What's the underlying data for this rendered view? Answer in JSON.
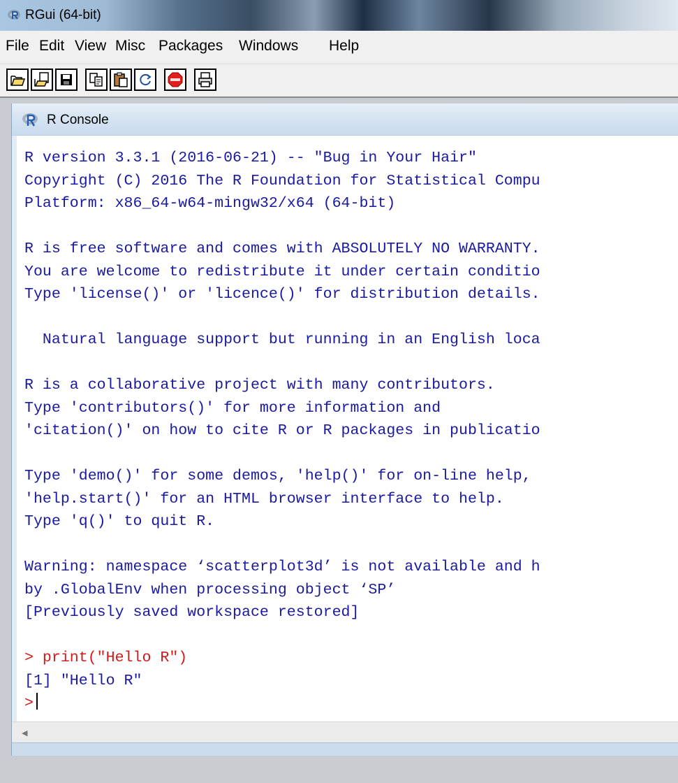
{
  "window": {
    "title": "RGui (64-bit)"
  },
  "menubar": {
    "items": [
      "File",
      "Edit",
      "View",
      "Misc",
      "Packages",
      "Windows",
      "Help"
    ]
  },
  "toolbar": {
    "buttons": [
      {
        "icon": "open-script-icon"
      },
      {
        "icon": "load-workspace-icon"
      },
      {
        "icon": "save-icon"
      },
      {
        "icon": "copy-icon"
      },
      {
        "icon": "paste-icon"
      },
      {
        "icon": "copy-paste-icon"
      },
      {
        "icon": "stop-icon"
      },
      {
        "icon": "print-icon"
      }
    ]
  },
  "console": {
    "title": "R Console",
    "lines": [
      {
        "text": "R version 3.3.1 (2016-06-21) -- \"Bug in Your Hair\"",
        "kind": "out"
      },
      {
        "text": "Copyright (C) 2016 The R Foundation for Statistical Compu",
        "kind": "out"
      },
      {
        "text": "Platform: x86_64-w64-mingw32/x64 (64-bit)",
        "kind": "out"
      },
      {
        "text": "",
        "kind": "out"
      },
      {
        "text": "R is free software and comes with ABSOLUTELY NO WARRANTY.",
        "kind": "out"
      },
      {
        "text": "You are welcome to redistribute it under certain conditio",
        "kind": "out"
      },
      {
        "text": "Type 'license()' or 'licence()' for distribution details.",
        "kind": "out"
      },
      {
        "text": "",
        "kind": "out"
      },
      {
        "text": "  Natural language support but running in an English loca",
        "kind": "out"
      },
      {
        "text": "",
        "kind": "out"
      },
      {
        "text": "R is a collaborative project with many contributors.",
        "kind": "out"
      },
      {
        "text": "Type 'contributors()' for more information and",
        "kind": "out"
      },
      {
        "text": "'citation()' on how to cite R or R packages in publicatio",
        "kind": "out"
      },
      {
        "text": "",
        "kind": "out"
      },
      {
        "text": "Type 'demo()' for some demos, 'help()' for on-line help,",
        "kind": "out"
      },
      {
        "text": "'help.start()' for an HTML browser interface to help.",
        "kind": "out"
      },
      {
        "text": "Type 'q()' to quit R.",
        "kind": "out"
      },
      {
        "text": "",
        "kind": "out"
      },
      {
        "text": "Warning: namespace ‘scatterplot3d’ is not available and h",
        "kind": "out"
      },
      {
        "text": "by .GlobalEnv when processing object ‘SP’",
        "kind": "out"
      },
      {
        "text": "[Previously saved workspace restored]",
        "kind": "out"
      },
      {
        "text": "",
        "kind": "out"
      },
      {
        "text": "> print(\"Hello R\")",
        "kind": "cmd"
      },
      {
        "text": "[1] \"Hello R\"",
        "kind": "out"
      }
    ],
    "prompt": ">",
    "input_value": ""
  },
  "colors": {
    "output_text": "#1a1aa0",
    "command_text": "#d21a1a",
    "stop_button": "#e0201c"
  }
}
